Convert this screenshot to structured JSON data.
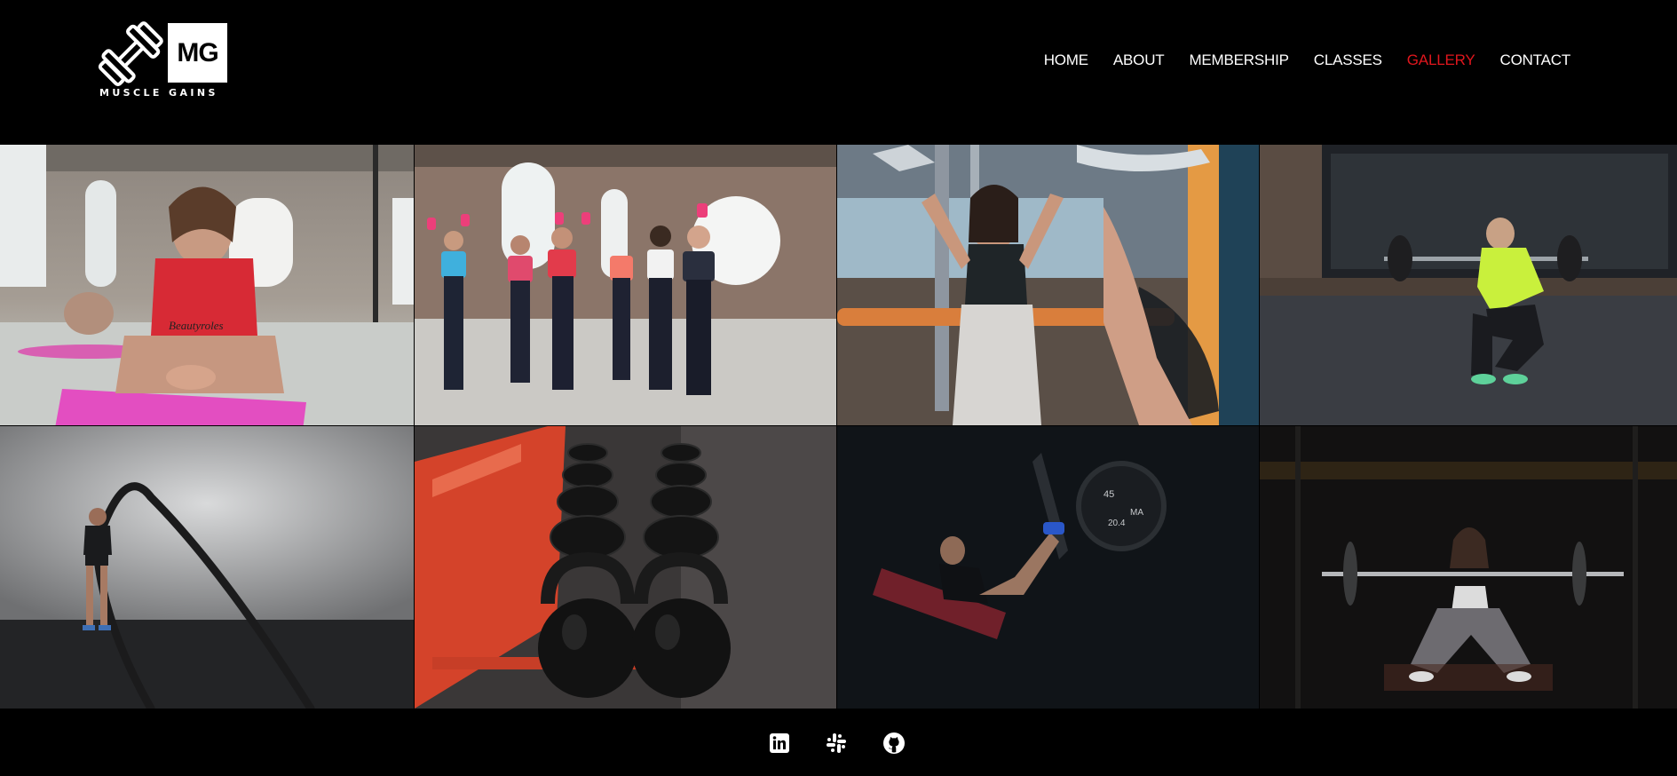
{
  "brand": {
    "monogram": "MG",
    "name": "MUSCLE GAINS",
    "logo_icon": "dumbbell-icon"
  },
  "nav": {
    "items": [
      {
        "label": "HOME"
      },
      {
        "label": "ABOUT"
      },
      {
        "label": "MEMBERSHIP"
      },
      {
        "label": "CLASSES"
      },
      {
        "label": "GALLERY",
        "active": true
      },
      {
        "label": "CONTACT"
      }
    ],
    "active_color": "#e0161d"
  },
  "gallery": {
    "photos": [
      {
        "subject": "woman-plank-yoga-mat"
      },
      {
        "subject": "group-dumbbell-class"
      },
      {
        "subject": "woman-lat-pulldown"
      },
      {
        "subject": "woman-barbell-squat"
      },
      {
        "subject": "woman-battle-ropes"
      },
      {
        "subject": "kettlebells-rack"
      },
      {
        "subject": "woman-leg-press"
      },
      {
        "subject": "woman-squat-barbell-dark"
      }
    ],
    "scene_text": [
      "Beautyroles",
      "45",
      "20.4",
      "MA"
    ]
  },
  "footer": {
    "social": [
      {
        "icon": "linkedin-icon"
      },
      {
        "icon": "slack-icon"
      },
      {
        "icon": "github-icon"
      }
    ]
  }
}
